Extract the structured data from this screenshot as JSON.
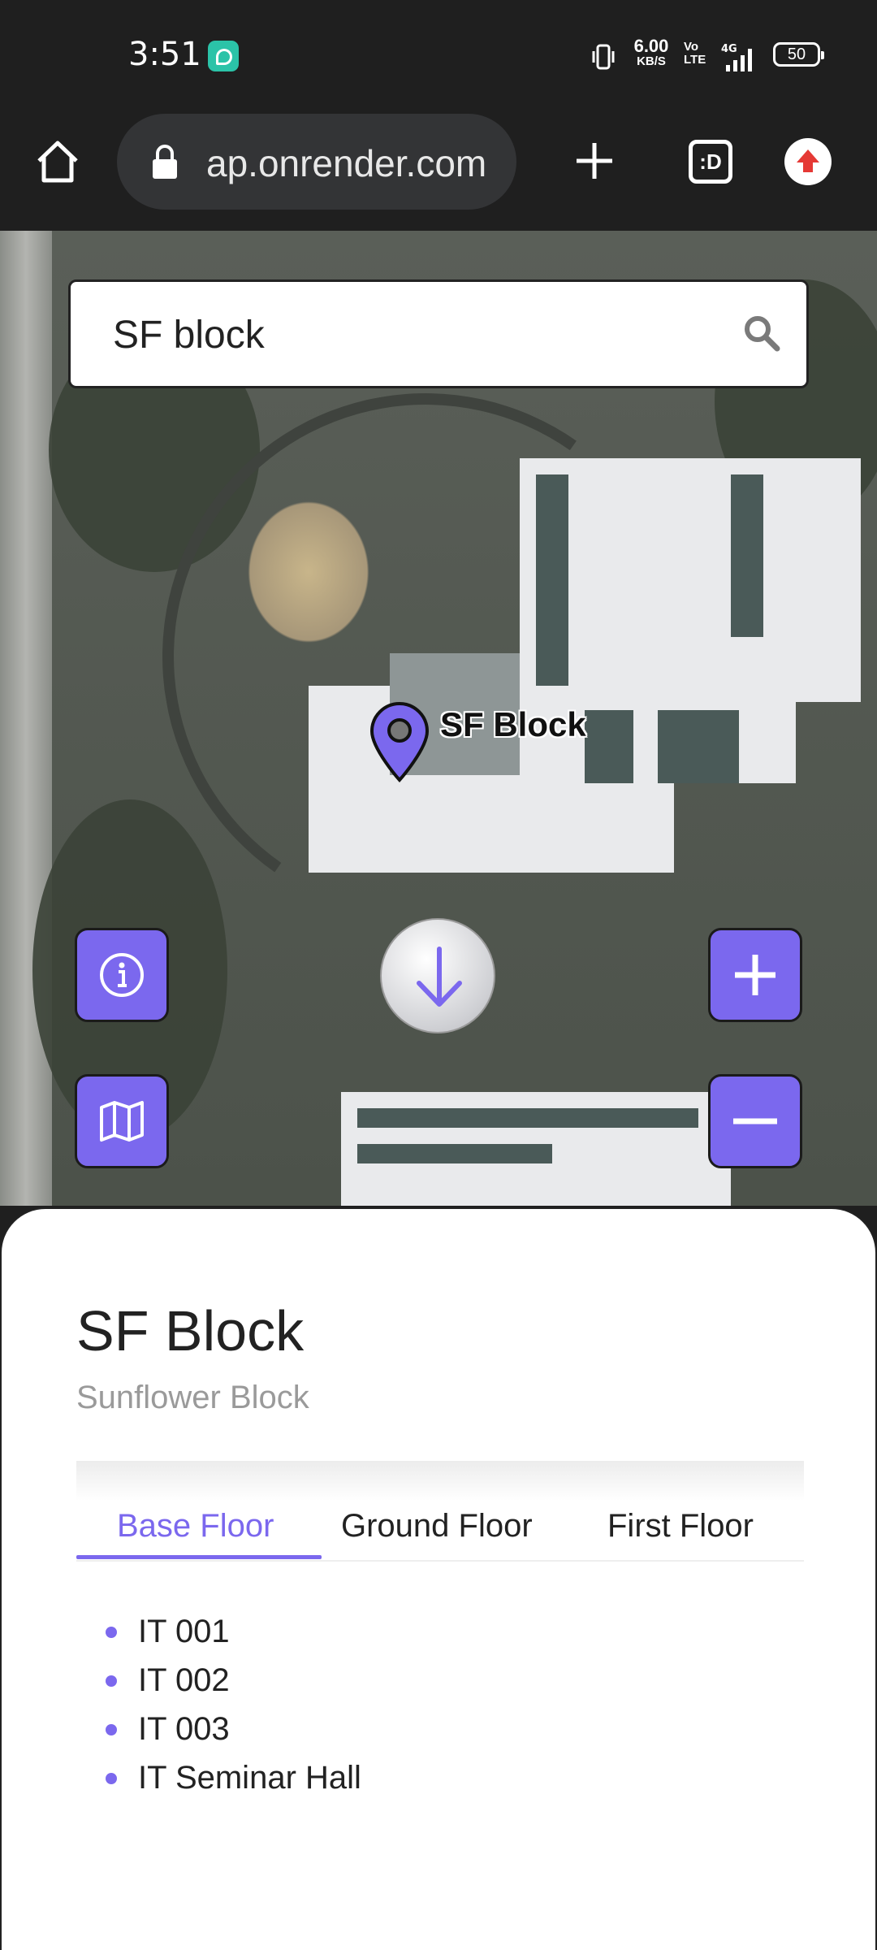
{
  "status_bar": {
    "time": "3:51",
    "net_speed_value": "6.00",
    "net_speed_unit": "KB/S",
    "network_label": "Vo\nLTE",
    "signal_label": "4G",
    "battery_level": "50"
  },
  "browser": {
    "url": "ap.onrender.com",
    "tabs_label": ":D"
  },
  "map": {
    "search": {
      "value": "SF block"
    },
    "marker_label": "SF Block",
    "accent_color": "#7b68ee"
  },
  "sheet": {
    "title": "SF Block",
    "subtitle": "Sunflower Block",
    "tabs": [
      {
        "label": "Base Floor",
        "active": true
      },
      {
        "label": "Ground Floor",
        "active": false
      },
      {
        "label": "First Floor",
        "active": false
      }
    ],
    "rooms": [
      "IT 001",
      "IT 002",
      "IT 003",
      "IT Seminar Hall"
    ]
  }
}
